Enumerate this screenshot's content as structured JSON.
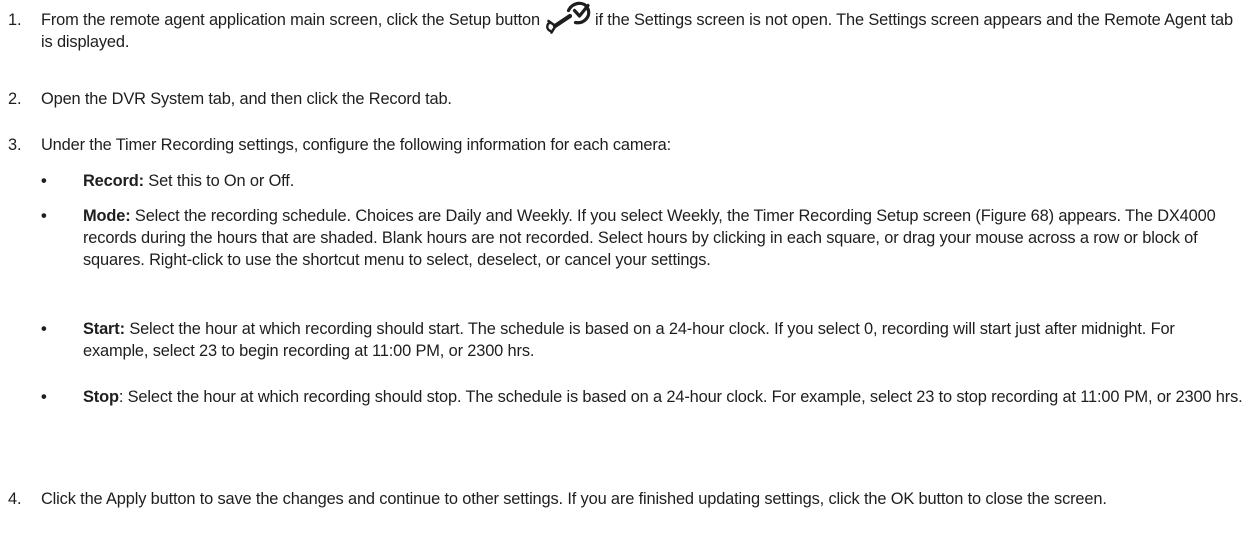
{
  "steps": [
    {
      "number": "1.",
      "text_before": "From the remote agent application main screen, click the Setup button",
      "icon": "setup-wrench-icon",
      "text_after": "if the Settings screen is not open. The Settings screen appears and the Remote Agent tab is displayed."
    },
    {
      "number": "2.",
      "text": "Open the DVR System tab, and then click the Record tab."
    },
    {
      "number": "3.",
      "text": "Under the Timer Recording settings, configure the following information for each camera:",
      "bullets": [
        {
          "symbol": "•",
          "term": "Record:",
          "text": "Set this to On or Off."
        },
        {
          "symbol": "•",
          "term": "Mode:",
          "text": "Select the recording schedule. Choices are Daily and Weekly. If you select Weekly, the Timer Recording Setup screen (Figure 68) appears. The DX4000 records during the hours that are shaded. Blank hours are not recorded. Select hours by clicking in each square, or drag your mouse across a row or block of squares. Right-click to use the shortcut menu to select, deselect, or cancel your settings."
        },
        {
          "symbol": "•",
          "term": "Start:",
          "text": "Select the hour at which recording should start. The schedule is based on a 24-hour clock. If you select 0, recording will start just after midnight. For example, select 23 to begin recording at 11:00 PM, or 2300 hrs."
        },
        {
          "symbol": "•",
          "term": "Stop",
          "text": ": Select the hour at which recording should stop. The schedule is based on a 24-hour clock. For example, select 23 to stop recording at 11:00 PM, or 2300 hrs."
        }
      ]
    },
    {
      "number": "4.",
      "text": "Click the Apply button to save the changes and continue to other settings. If you are finished updating settings, click the OK button to close the screen."
    }
  ]
}
